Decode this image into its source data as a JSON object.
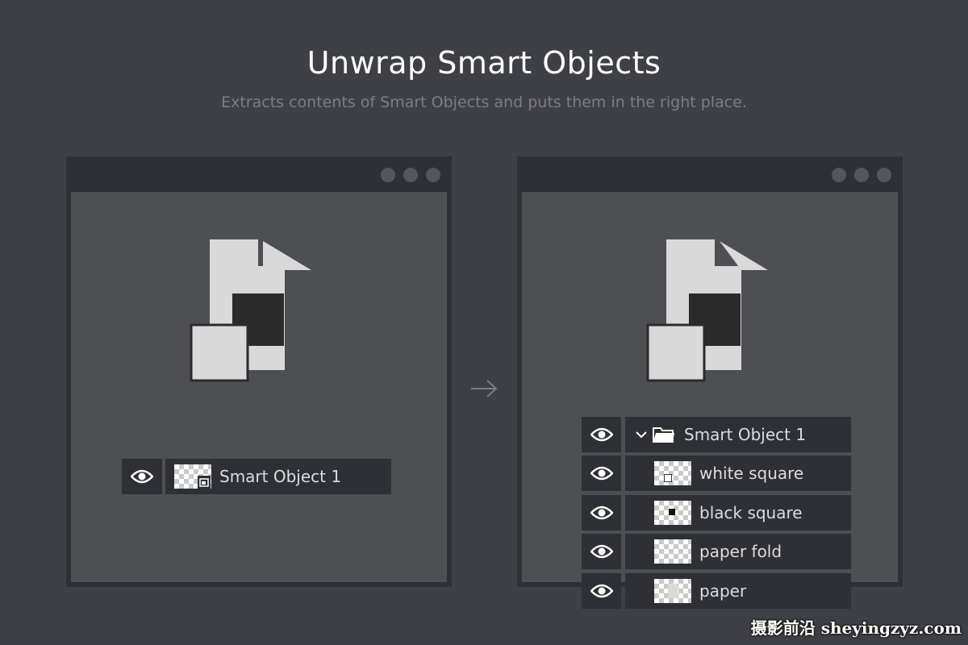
{
  "header": {
    "title": "Unwrap Smart Objects",
    "subtitle": "Extracts contents of Smart Objects and puts them in the right place."
  },
  "before_panel": {
    "layer": {
      "name": "Smart Object 1",
      "icon": "smart-object-thumbnail"
    }
  },
  "after_panel": {
    "group": {
      "name": "Smart Object 1",
      "icon": "folder-icon",
      "expanded": true
    },
    "layers": [
      {
        "name": "white square"
      },
      {
        "name": "black square"
      },
      {
        "name": "paper fold"
      },
      {
        "name": "paper"
      }
    ]
  },
  "watermark": "摄影前沿 sheyingzyz.com",
  "colors": {
    "background": "#3f4045",
    "window_frame": "#2f3035",
    "window_content": "#4e4f53",
    "paper": "#d9d9d9",
    "dark_square": "#2b2b2b"
  }
}
